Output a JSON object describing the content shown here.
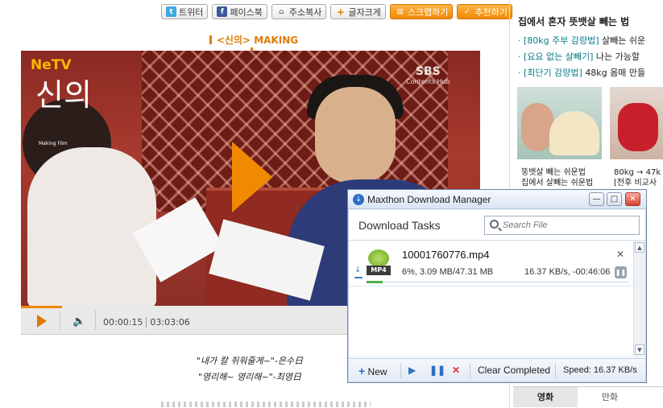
{
  "share": {
    "twitter": "트위터",
    "facebook": "페이스북",
    "copy_url": "주소복사",
    "font_size": "글자크게",
    "scrap": "스크랩하기",
    "recommend": "추천하기"
  },
  "section_title": "<신의> MAKING",
  "video": {
    "channel_logo": "NeTV",
    "drama_title": "신의",
    "subtitle": "Making Film",
    "broadcaster": "SBS",
    "broadcaster_sub": "Contents Hub",
    "current_time": "00:00:15",
    "total_time": "03:03:06",
    "progress_fraction": 0.09
  },
  "quotes": [
    "\"내가 칼 쥐워줄게~\"-은수日",
    "\"영리해~ 영리해~\"-최영日"
  ],
  "sidebar": {
    "title": "집에서 혼자 뜻뱃살 빼는 법",
    "items": [
      {
        "tag": "[80kg 주부 감량법]",
        "text": "살빼는 쉬운"
      },
      {
        "tag": "[요요 없는 살빼기]",
        "text": "나는 가능할"
      },
      {
        "tag": "[최단기 감량법]",
        "text": "48kg 몸매 만들"
      }
    ],
    "caption1_line1": "뚱뱃살 빼는 쉬운법",
    "caption1_line2": "집에서 살빼는 쉬운법",
    "caption2_line1": "80kg → 47k",
    "caption2_line2": "[전후 비교사",
    "tabs": [
      "영화",
      "만화"
    ]
  },
  "dialog": {
    "title": "Maxthon Download Manager",
    "header": "Download Tasks",
    "search_placeholder": "Search File",
    "file": {
      "name": "10001760776.mp4",
      "format": "MP4",
      "status": "6%, 3.09 MB/47.31 MB",
      "speed_remaining": "16.37 KB/s, -00:46:06",
      "progress_fraction": 0.06
    },
    "footer": {
      "new": "New",
      "clear": "Clear Completed",
      "speed": "Speed: 16.37 KB/s"
    }
  },
  "colors": {
    "accent": "#f08a00",
    "dialog_border": "#6f86a6"
  }
}
